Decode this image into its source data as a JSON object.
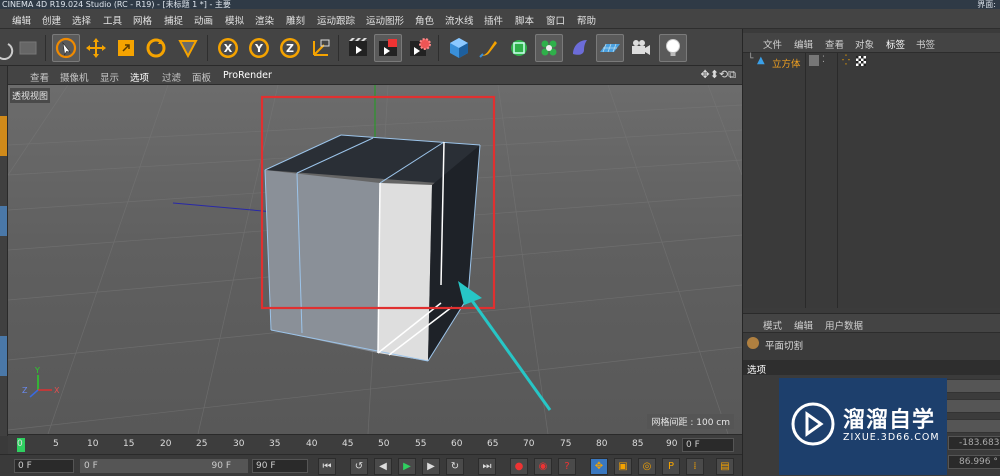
{
  "window": {
    "title": "CINEMA 4D R19.024 Studio (RC - R19) - [未标题 1 *] - 主要",
    "layout_label": "界面:"
  },
  "menu": [
    "编辑",
    "创建",
    "选择",
    "工具",
    "网格",
    "捕捉",
    "动画",
    "模拟",
    "渲染",
    "雕刻",
    "运动跟踪",
    "运动图形",
    "角色",
    "流水线",
    "插件",
    "脚本",
    "窗口",
    "帮助"
  ],
  "toolbar": {
    "axis_x": "X",
    "axis_y": "Y",
    "axis_z": "Z"
  },
  "viewport": {
    "menu": [
      "查看",
      "摄像机",
      "显示",
      "选项",
      "过滤",
      "面板",
      "ProRender"
    ],
    "active_menu": "选项",
    "view_name": "透视视图",
    "grid_spacing": "网格间距 : 100 cm",
    "axis_labels": {
      "y": "Y",
      "z": "Z",
      "x": "X"
    }
  },
  "timeline": {
    "ticks": [
      "0",
      "5",
      "10",
      "15",
      "20",
      "25",
      "30",
      "35",
      "40",
      "45",
      "50",
      "55",
      "60",
      "65",
      "70",
      "75",
      "80",
      "85",
      "90"
    ],
    "current_frame": "0 F"
  },
  "playback": {
    "start_field": "0 F",
    "min_field": "0 F",
    "max_field": "90 F",
    "end_field": "90 F"
  },
  "object_manager": {
    "menu": [
      "文件",
      "编辑",
      "查看",
      "对象",
      "标签",
      "书签"
    ],
    "active_menu": "标签",
    "objects": [
      {
        "name": "立方体"
      }
    ]
  },
  "attribute_manager": {
    "menu": [
      "模式",
      "编辑",
      "用户数据"
    ],
    "tool_name": "平面切割",
    "section": "选项",
    "values": [
      "-183.683",
      "86.996 °"
    ]
  },
  "watermark": {
    "brand": "溜溜自学",
    "url": "ZIXUE.3D66.COM"
  },
  "colors": {
    "selection_red": "#e03030",
    "arrow_cyan": "#27c6c6",
    "cube_light": "#dedede",
    "cube_mid": "#8a929a",
    "cube_dark": "#1e2228"
  }
}
